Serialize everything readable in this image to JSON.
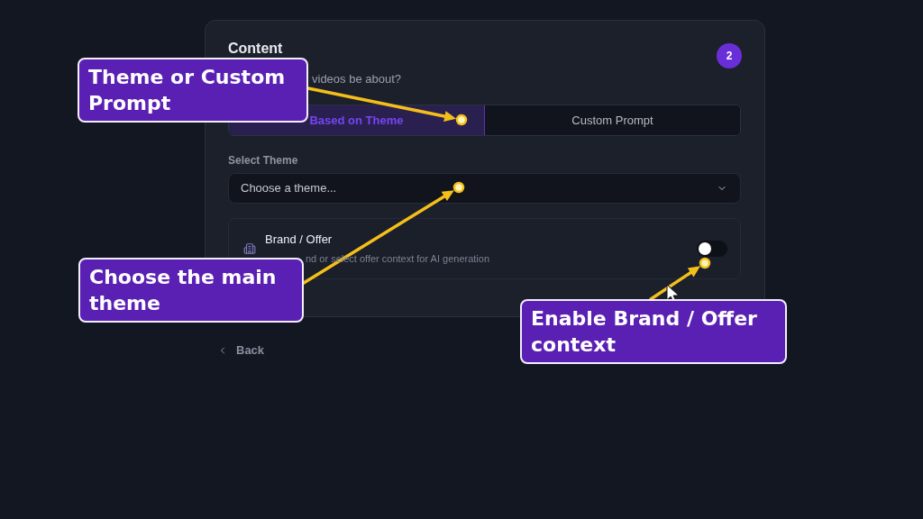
{
  "card": {
    "title": "Content",
    "step_badge": "2",
    "question": "videos be about?",
    "source_tabs": [
      {
        "label": "Based on Theme",
        "selected": true
      },
      {
        "label": "Custom Prompt",
        "selected": false
      }
    ],
    "theme_select": {
      "label": "Select Theme",
      "placeholder": "Choose a theme..."
    },
    "brand_offer": {
      "title": "Brand / Offer",
      "description": "nd or select offer context for AI generation",
      "on": false
    }
  },
  "footer": {
    "back": "Back"
  },
  "annotations": [
    {
      "text": "Theme or Custom Prompt"
    },
    {
      "text": "Choose the main theme"
    },
    {
      "text": "Enable Brand / Offer context"
    }
  ]
}
